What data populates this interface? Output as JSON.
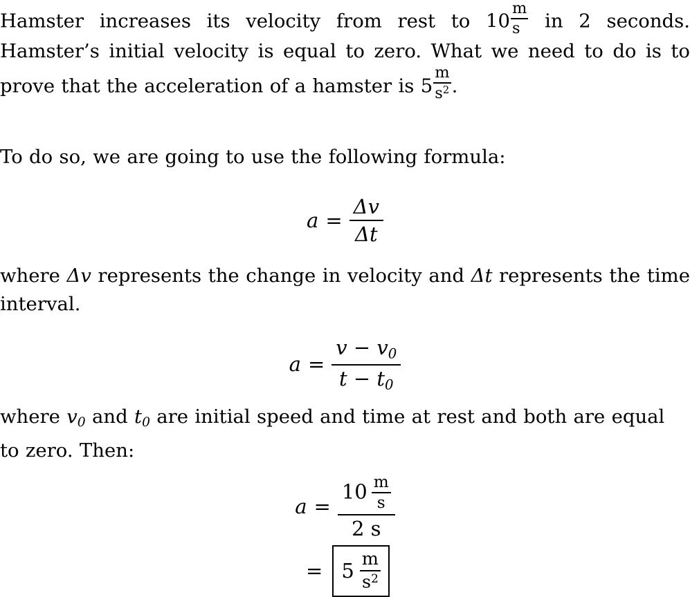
{
  "document": {
    "type": "physics-worked-solution",
    "topic": "acceleration",
    "paragraphs": {
      "intro": {
        "p1": "Hamster increases its velocity from rest to 10",
        "p2": "in 2 seconds. Hamster’s initial velocity is equal to zero. What we need to do is to prove that the acceleration of a hamster is 5",
        "p3": "."
      },
      "lead_in": "To do so, we are going to use the following formula:",
      "where_1": {
        "p1": "where",
        "delta_v": "Δv",
        "p2": "represents the change in velocity and",
        "delta_t": "Δt",
        "p3": "represents the time interval."
      },
      "where_2": {
        "p1": "where",
        "v0": "v",
        "v0_sub": "0",
        "p2": "and",
        "t0": "t",
        "t0_sub": "0",
        "p3": "are initial speed and time at rest and both are equal to zero. Then:"
      }
    },
    "units": {
      "meter": "m",
      "second": "s",
      "second_squared_base": "s",
      "second_squared_exp": "2"
    },
    "equations": {
      "eq1": {
        "lhs": "a",
        "relation": "=",
        "numerator": "Δv",
        "denominator": "Δt"
      },
      "eq2": {
        "lhs": "a",
        "relation": "=",
        "numerator": "v − v",
        "numerator_sub": "0",
        "denominator": "t − t",
        "denominator_sub": "0"
      },
      "eq3": {
        "lhs": "a",
        "relation": "=",
        "numerator_value": "10",
        "numerator_unit_num": "m",
        "numerator_unit_den": "s",
        "denominator": "2 s"
      },
      "eq4": {
        "relation": "=",
        "value": "5",
        "unit_num": "m",
        "unit_den_base": "s",
        "unit_den_exp": "2",
        "boxed": true
      }
    }
  },
  "colors": {
    "text": "#000000",
    "background": "#ffffff",
    "rule": "#000000"
  }
}
